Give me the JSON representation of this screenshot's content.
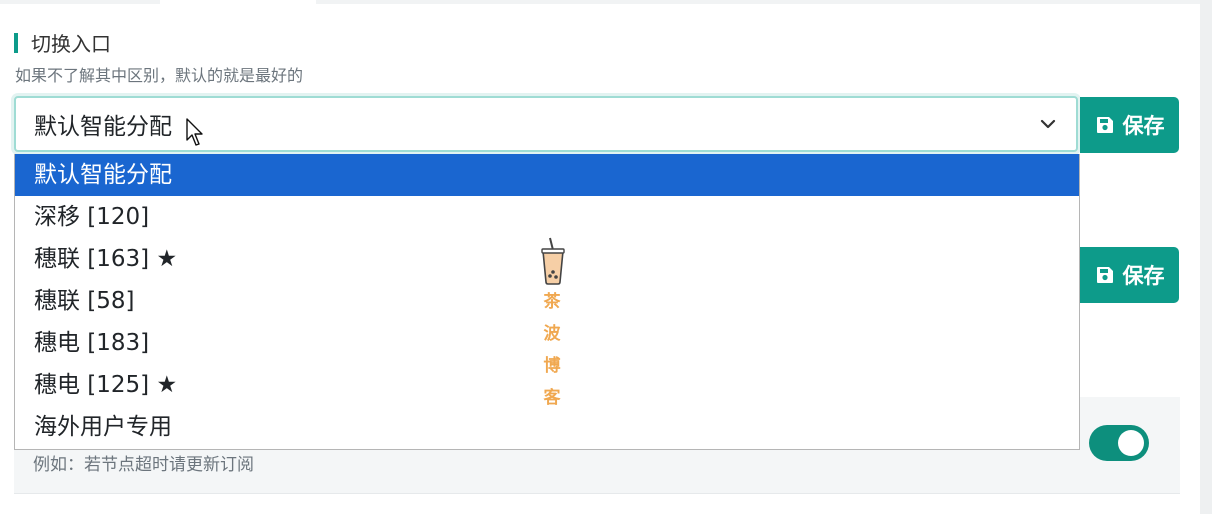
{
  "section": {
    "title": "切换入口",
    "description": "如果不了解其中区别，默认的就是最好的"
  },
  "select": {
    "current_value": "默认智能分配",
    "options": [
      "默认智能分配",
      "深移 [120]",
      "穗联 [163] ★",
      "穗联 [58]",
      "穗电 [183]",
      "穗电 [125] ★",
      "海外用户专用"
    ],
    "selected_index": 0
  },
  "buttons": {
    "save_label": "保存"
  },
  "lower": {
    "hint": "例如：若节点超时请更新订阅",
    "toggle_on": true
  },
  "watermark": {
    "line1": "茶 波",
    "line2": "博 客"
  },
  "colors": {
    "accent": "#0d9b8a",
    "selected_option": "#1a66d0",
    "watermark": "#f0a850"
  },
  "icons": [
    "chevron-down-icon",
    "save-icon",
    "mouse-cursor-icon",
    "bubble-tea-icon"
  ]
}
